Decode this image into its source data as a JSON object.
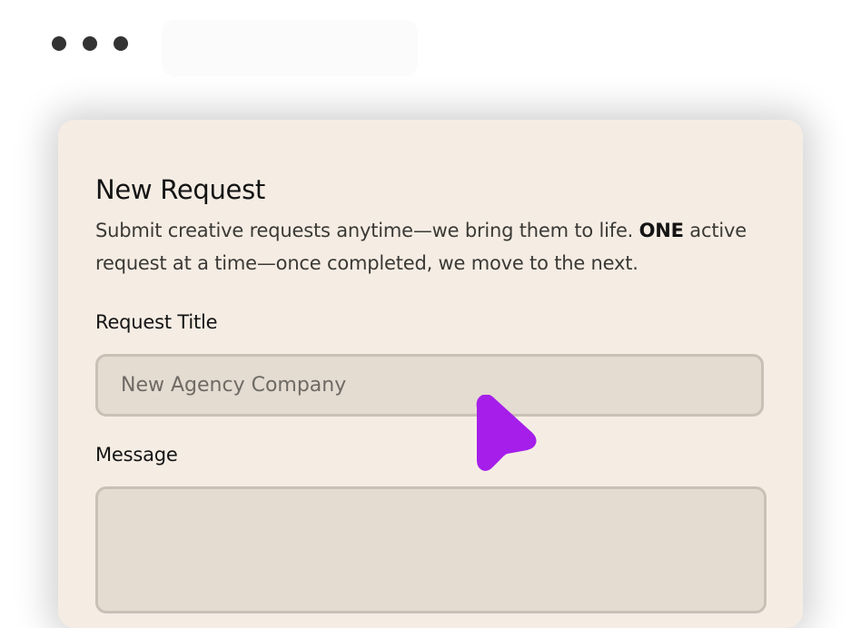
{
  "window": {
    "dots": [
      "dot",
      "dot",
      "dot"
    ]
  },
  "form": {
    "title": "New Request",
    "description_part1": "Submit creative requests anytime—we bring them to life. ",
    "description_emphasis": "ONE",
    "description_part2": " active request at a time—once completed, we move to the next.",
    "request_title_label": "Request Title",
    "request_title_value": "New Agency Company",
    "message_label": "Message",
    "message_value": ""
  },
  "colors": {
    "card_background": "#f5ede4",
    "field_background": "#e4dbd1",
    "field_border": "#c9c0b6",
    "cursor": "#a51eea"
  },
  "icons": {
    "cursor": "pointer-cursor-icon"
  }
}
